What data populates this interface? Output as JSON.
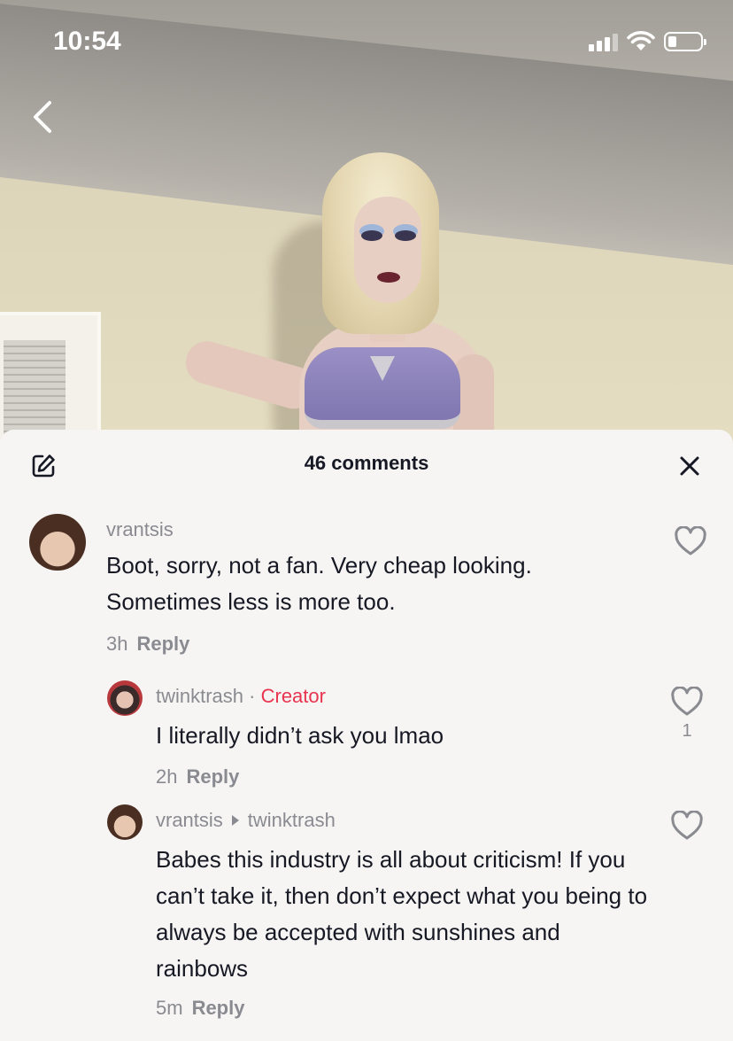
{
  "status_bar": {
    "time": "10:54"
  },
  "comments_panel": {
    "count_label": "46 comments",
    "reply_label": "Reply"
  },
  "comments": [
    {
      "username": "vrantsis",
      "text": "Boot, sorry, not a fan. Very cheap looking. Sometimes less is more too.",
      "time": "3h",
      "likes": ""
    },
    {
      "username": "twinktrash",
      "badge_separator": " · ",
      "badge": "Creator",
      "text": "I literally didn’t ask you lmao",
      "time": "2h",
      "likes": "1"
    },
    {
      "username": "vrantsis",
      "reply_to": "twinktrash",
      "text": "Babes this industry is all about criticism! If you can’t take it, then don’t expect what you being to always be accepted with sunshines and rainbows",
      "time": "5m",
      "likes": ""
    }
  ],
  "colors": {
    "sheet_background": "#f6f5f4",
    "primary_text": "#161823",
    "secondary_text": "#8a8b91",
    "creator_badge": "#e8344f"
  },
  "icons": [
    "back-chevron-icon",
    "signal-icon",
    "wifi-icon",
    "battery-icon",
    "edit-icon",
    "close-icon",
    "heart-icon"
  ]
}
